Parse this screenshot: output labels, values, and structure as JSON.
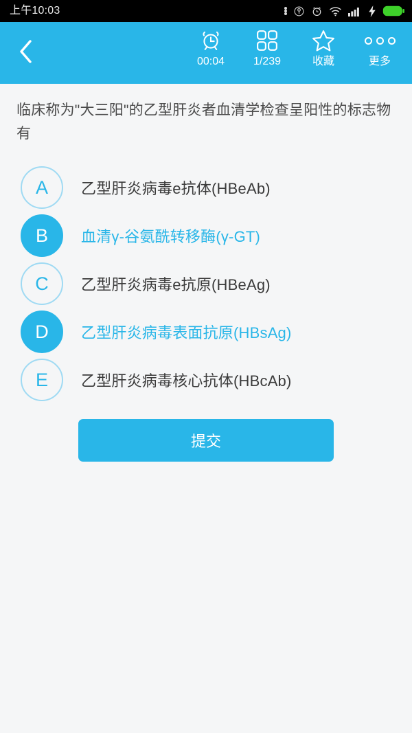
{
  "statusbar": {
    "time": "上午10:03",
    "icons": [
      "ellipsis-icon",
      "nfc-icon",
      "alarm-icon",
      "wifi-icon",
      "signal-icon",
      "charging-bolt-icon",
      "battery-icon"
    ],
    "battery_color": "#3ed12a"
  },
  "header": {
    "background_color": "#29b6e8",
    "back_icon": "chevron-left-icon",
    "actions": [
      {
        "icon": "alarm-clock-icon",
        "label": "00:04",
        "name": "timer"
      },
      {
        "icon": "grid-icon",
        "label": "1/239",
        "name": "question-index"
      },
      {
        "icon": "star-outline-icon",
        "label": "收藏",
        "name": "favorite"
      },
      {
        "icon": "three-dots-icon",
        "label": "更多",
        "name": "more"
      }
    ]
  },
  "question": {
    "text": "临床称为\"大三阳\"的乙型肝炎者血清学检查呈阳性的标志物有"
  },
  "options": [
    {
      "letter": "A",
      "text": "乙型肝炎病毒e抗体(HBeAb)",
      "selected": false
    },
    {
      "letter": "B",
      "text": "血清γ-谷氨酰转移酶(γ-GT)",
      "selected": true
    },
    {
      "letter": "C",
      "text": "乙型肝炎病毒e抗原(HBeAg)",
      "selected": false
    },
    {
      "letter": "D",
      "text": "乙型肝炎病毒表面抗原(HBsAg)",
      "selected": true
    },
    {
      "letter": "E",
      "text": "乙型肝炎病毒核心抗体(HBcAb)",
      "selected": false
    }
  ],
  "submit": {
    "label": "提交",
    "color": "#29b6e8"
  },
  "colors": {
    "accent": "#29b6e8",
    "accent_light": "#9fdaf3",
    "page_background": "#f5f6f7",
    "text_primary": "#3b3b3b",
    "text_question": "#4a4a4a"
  }
}
